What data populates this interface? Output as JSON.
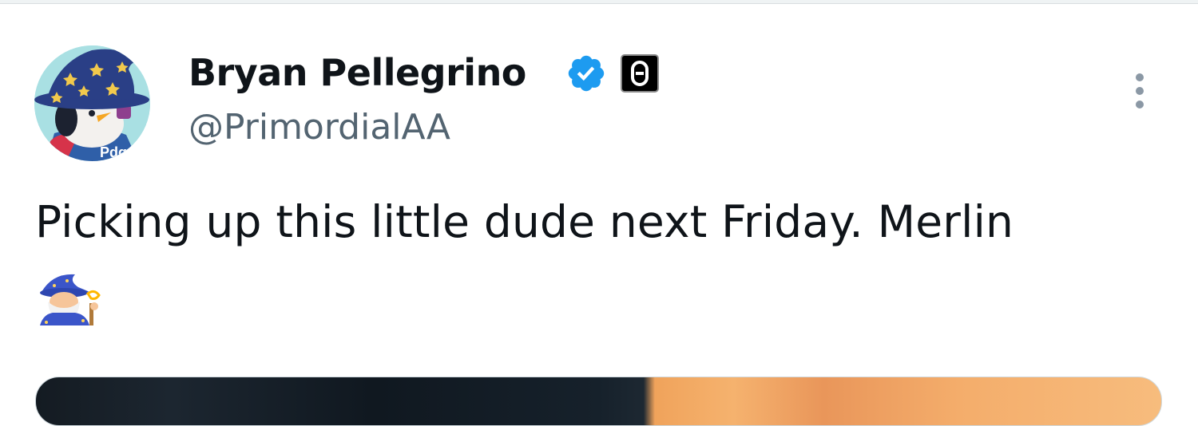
{
  "tweet": {
    "author": {
      "name": "Bryan Pellegrino",
      "handle": "@PrimordialAA",
      "verified": true,
      "verified_color": "#1d9bf0",
      "affiliate_badge_icon": "layerzero-logo-icon",
      "avatar_icon": "penguin-wizard-avatar"
    },
    "text": "Picking up this little dude next Friday. Merlin",
    "emoji": "mage-emoji",
    "more_icon": "vertical-ellipsis-icon"
  }
}
